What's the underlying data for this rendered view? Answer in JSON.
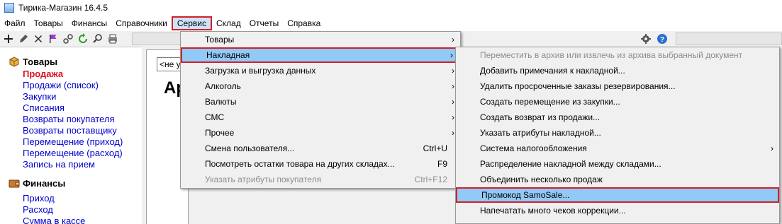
{
  "window": {
    "title": "Тирика-Магазин 16.4.5"
  },
  "menubar": {
    "items": [
      "Файл",
      "Товары",
      "Финансы",
      "Справочники",
      "Сервис",
      "Склад",
      "Отчеты",
      "Справка"
    ]
  },
  "toolbar": {
    "icons": [
      "add-icon",
      "edit-icon",
      "delete-icon",
      "flag-icon",
      "link-icon",
      "refresh-icon",
      "search-icon",
      "print-icon"
    ],
    "right_icons": [
      "settings-icon",
      "help-icon"
    ]
  },
  "sidebar": {
    "sections": [
      {
        "title": "Товары",
        "icon": "box-icon",
        "items": [
          "Продажа",
          "Продажи (список)",
          "Закупки",
          "Списания",
          "Возвраты покупателя",
          "Возвраты поставщику",
          "Перемещение (приход)",
          "Перемещение (расход)",
          "Запись на прием"
        ]
      },
      {
        "title": "Финансы",
        "icon": "wallet-icon",
        "items": [
          "Приход",
          "Расход",
          "Сумма в кассе"
        ]
      }
    ]
  },
  "main": {
    "combo_text": "<не ук",
    "big_text": "Ар"
  },
  "service_menu": {
    "items": [
      {
        "label": "Товары",
        "submenu": true
      },
      {
        "label": "Накладная",
        "submenu": true,
        "highlighted": true
      },
      {
        "label": "Загрузка и выгрузка данных",
        "submenu": true
      },
      {
        "label": "Алкоголь",
        "submenu": true
      },
      {
        "label": "Валюты",
        "submenu": true
      },
      {
        "label": "СМС",
        "submenu": true
      },
      {
        "label": "Прочее",
        "submenu": true
      },
      {
        "label": "Смена пользователя...",
        "shortcut": "Ctrl+U"
      },
      {
        "label": "Посмотреть остатки товара на других складах...",
        "shortcut": "F9"
      },
      {
        "label": "Указать атрибуты покупателя",
        "shortcut": "Ctrl+F12",
        "disabled": true
      }
    ]
  },
  "invoice_menu": {
    "items": [
      {
        "label": "Переместить в архив или извлечь из архива выбранный документ",
        "disabled": true
      },
      {
        "label": "Добавить примечания к накладной..."
      },
      {
        "label": "Удалить просроченные заказы резервирования..."
      },
      {
        "label": "Создать перемещение из закупки..."
      },
      {
        "label": "Создать возврат из продажи..."
      },
      {
        "label": "Указать атрибуты накладной..."
      },
      {
        "label": "Система налогообложения",
        "submenu": true
      },
      {
        "label": "Распределение накладной между складами..."
      },
      {
        "label": "Объединить несколько продаж"
      },
      {
        "label": "Промокод SamoSale...",
        "highlighted": true
      },
      {
        "label": "Напечатать много чеков коррекции..."
      }
    ]
  },
  "colors": {
    "highlight": "#91c9f7",
    "highlight_border": "#d31f2a",
    "link": "#0000cc",
    "current_link": "#e01020"
  }
}
